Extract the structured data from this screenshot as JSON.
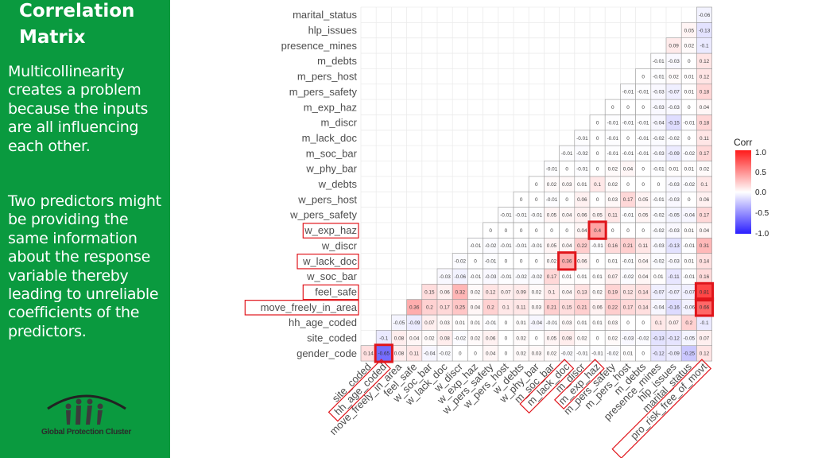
{
  "sidebar": {
    "title": "Correlation Matrix",
    "paragraph1": "Multicollinearity creates a problem because the inputs are all influencing each other.",
    "paragraph2": "Two predictors might be providing the same information about the response variable thereby leading to unreliable coefficients of the predictors.",
    "logo_text": "Global Protection Cluster",
    "background_color": "#0a9a3f"
  },
  "chart_data": {
    "type": "heatmap",
    "title": "",
    "variables": [
      "gender_code",
      "site_coded",
      "hh_age_coded",
      "move_freely_in_area",
      "feel_safe",
      "w_soc_bar",
      "w_lack_doc",
      "w_discr",
      "w_exp_haz",
      "w_pers_safety",
      "w_pers_host",
      "w_debts",
      "w_phy_bar",
      "m_soc_bar",
      "m_lack_doc",
      "m_discr",
      "m_exp_haz",
      "m_pers_safety",
      "m_pers_host",
      "m_debts",
      "presence_mines",
      "hlp_issues",
      "marital_status",
      "pro_risk_free_of_movt"
    ],
    "row_labels_top_to_bottom": [
      "marital_status",
      "hlp_issues",
      "presence_mines",
      "m_debts",
      "m_pers_host",
      "m_pers_safety",
      "m_exp_haz",
      "m_discr",
      "m_lack_doc",
      "m_soc_bar",
      "w_phy_bar",
      "w_debts",
      "w_pers_host",
      "w_pers_safety",
      "w_exp_haz",
      "w_discr",
      "w_lack_doc",
      "w_soc_bar",
      "feel_safe",
      "move_freely_in_area",
      "hh_age_coded",
      "site_coded",
      "gender_code"
    ],
    "column_labels_left_to_right": [
      "site_coded",
      "hh_age_coded",
      "move_freely_in_area",
      "feel_safe",
      "w_soc_bar",
      "w_lack_doc",
      "w_discr",
      "w_exp_haz",
      "w_pers_safety",
      "w_pers_host",
      "w_debts",
      "w_phy_bar",
      "m_soc_bar",
      "m_lack_doc",
      "m_discr",
      "m_exp_haz",
      "m_pers_safety",
      "m_pers_host",
      "m_debts",
      "presence_mines",
      "hlp_issues",
      "marital_status",
      "pro_risk_free_of_movt"
    ],
    "rows": [
      {
        "label": "gender_code",
        "values": [
          0.14,
          -0.65,
          0.08,
          0.11,
          -0.04,
          -0.02,
          0,
          0,
          0.04,
          0,
          0.02,
          0.03,
          0.02,
          -0.02,
          -0.01,
          -0.01,
          -0.02,
          0.01,
          0,
          -0.12,
          -0.09,
          -0.25,
          0.12
        ]
      },
      {
        "label": "site_coded",
        "values": [
          -0.1,
          0.08,
          0.04,
          0.02,
          0.08,
          -0.02,
          0.02,
          0.06,
          0,
          0.02,
          0,
          0.05,
          0.08,
          0.02,
          0,
          0.02,
          -0.03,
          -0.02,
          -0.13,
          -0.12,
          -0.05,
          0.07
        ]
      },
      {
        "label": "hh_age_coded",
        "values": [
          -0.05,
          -0.09,
          0.07,
          0.03,
          0.01,
          0.01,
          -0.01,
          0,
          0.01,
          -0.04,
          -0.01,
          0.03,
          0.01,
          0.01,
          0.03,
          0,
          0,
          0.1,
          0.07,
          0.2,
          -0.1
        ]
      },
      {
        "label": "move_freely_in_area",
        "values": [
          0.36,
          0.2,
          0.17,
          0.25,
          0.04,
          0.2,
          0.1,
          0.11,
          0.03,
          0.21,
          0.15,
          0.21,
          0.06,
          0.22,
          0.17,
          0.14,
          -0.04,
          -0.16,
          -0.06,
          0.66
        ]
      },
      {
        "label": "feel_safe",
        "values": [
          0.15,
          0.06,
          0.32,
          0.02,
          0.12,
          0.07,
          0.09,
          0.02,
          0.1,
          0.04,
          0.13,
          0.02,
          0.19,
          0.12,
          0.14,
          -0.07,
          -0.07,
          -0.07,
          0.81
        ]
      },
      {
        "label": "w_soc_bar",
        "values": [
          -0.03,
          -0.06,
          -0.01,
          -0.03,
          -0.01,
          -0.02,
          -0.02,
          0.17,
          0.01,
          0.01,
          0.01,
          0.07,
          -0.02,
          0.04,
          0.01,
          -0.11,
          -0.01,
          0.16
        ]
      },
      {
        "label": "w_lack_doc",
        "values": [
          -0.02,
          0,
          -0.01,
          0,
          0,
          0,
          0.02,
          0.36,
          0.06,
          0,
          0.01,
          -0.01,
          0.04,
          -0.02,
          -0.03,
          0.01,
          0.14
        ]
      },
      {
        "label": "w_discr",
        "values": [
          -0.01,
          -0.02,
          -0.01,
          -0.01,
          -0.01,
          0.05,
          0.04,
          0.22,
          -0.01,
          0.16,
          0.21,
          0.11,
          -0.03,
          -0.13,
          -0.01,
          0.31
        ]
      },
      {
        "label": "w_exp_haz",
        "values": [
          0,
          0,
          0,
          0,
          0,
          0,
          0.04,
          0.4,
          0,
          0,
          0,
          -0.02,
          -0.03,
          0.01,
          0.04
        ]
      },
      {
        "label": "w_pers_safety",
        "values": [
          -0.01,
          -0.01,
          -0.01,
          0.05,
          0.04,
          0.06,
          0.05,
          0.11,
          -0.01,
          0.05,
          -0.02,
          -0.05,
          -0.04,
          0.17
        ]
      },
      {
        "label": "w_pers_host",
        "values": [
          0,
          0,
          -0.01,
          0,
          0.06,
          0,
          0.03,
          0.17,
          0.05,
          -0.01,
          -0.03,
          0,
          0.06
        ]
      },
      {
        "label": "w_debts",
        "values": [
          0,
          0.02,
          0.03,
          0.01,
          0.1,
          0.02,
          0,
          0,
          0,
          -0.03,
          -0.02,
          0.1
        ]
      },
      {
        "label": "w_phy_bar",
        "values": [
          -0.01,
          0,
          -0.01,
          0,
          0.02,
          0.04,
          0,
          -0.01,
          0.01,
          0.01,
          0.02
        ]
      },
      {
        "label": "m_soc_bar",
        "values": [
          -0.01,
          -0.02,
          0,
          -0.01,
          -0.01,
          -0.01,
          -0.03,
          -0.09,
          -0.02,
          0.17
        ]
      },
      {
        "label": "m_lack_doc",
        "values": [
          -0.01,
          0,
          -0.01,
          0,
          -0.01,
          -0.02,
          -0.02,
          0,
          0.11
        ]
      },
      {
        "label": "m_discr",
        "values": [
          0,
          -0.01,
          -0.01,
          -0.01,
          -0.04,
          -0.15,
          -0.01,
          0.18
        ]
      },
      {
        "label": "m_exp_haz",
        "values": [
          0,
          0,
          0,
          -0.03,
          -0.03,
          0,
          0.04
        ]
      },
      {
        "label": "m_pers_safety",
        "values": [
          -0.01,
          -0.01,
          -0.03,
          -0.07,
          0.01,
          0.18
        ]
      },
      {
        "label": "m_pers_host",
        "values": [
          0,
          -0.01,
          0.02,
          0.01,
          0.12
        ]
      },
      {
        "label": "m_debts",
        "values": [
          -0.01,
          -0.03,
          0,
          0.12
        ]
      },
      {
        "label": "presence_mines",
        "values": [
          0.09,
          0.02,
          -0.1
        ]
      },
      {
        "label": "hlp_issues",
        "values": [
          0.05,
          -0.13
        ]
      },
      {
        "label": "marital_status",
        "values": [
          -0.06
        ]
      }
    ],
    "color_scale": {
      "low": "#2b1fff",
      "mid": "#ffffff",
      "high": "#ff1a1a",
      "range": [
        -1.0,
        1.0
      ]
    },
    "legend": {
      "title": "Corr",
      "ticks": [
        "1.0",
        "0.5",
        "0.0",
        "-0.5",
        "-1.0"
      ],
      "placement": "right"
    },
    "grid": true,
    "highlighted_cells": [
      {
        "row": "gender_code",
        "col": "hh_age_coded",
        "value": -0.65
      },
      {
        "row": "w_exp_haz",
        "col": "m_exp_haz",
        "value": 0.4
      },
      {
        "row": "w_lack_doc",
        "col": "m_lack_doc",
        "value": 0.36
      },
      {
        "row": "feel_safe",
        "col": "pro_risk_free_of_movt",
        "value": 0.81
      },
      {
        "row": "move_freely_in_area",
        "col": "pro_risk_free_of_movt",
        "value": 0.66
      }
    ],
    "highlighted_row_labels": [
      "w_exp_haz",
      "w_lack_doc",
      "feel_safe",
      "move_freely_in_area"
    ],
    "highlighted_column_labels": [
      "hh_age_coded",
      "m_lack_doc",
      "m_exp_haz",
      "pro_risk_free_of_movt"
    ],
    "highlight_color": "#e0151b"
  }
}
